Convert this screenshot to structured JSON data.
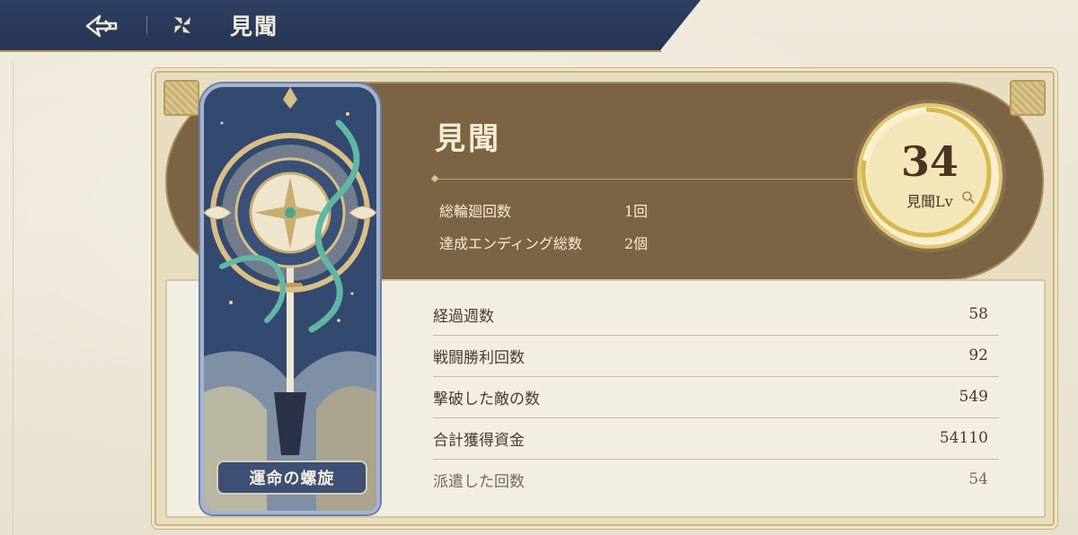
{
  "header": {
    "title": "見聞"
  },
  "card": {
    "name": "運命の螺旋"
  },
  "summary": {
    "title": "見聞",
    "stats": [
      {
        "label": "総輪廻回数",
        "value": "1回"
      },
      {
        "label": "達成エンディング総数",
        "value": "2個"
      }
    ],
    "level": {
      "value": "34",
      "label": "見聞Lv",
      "progress": 0.78
    }
  },
  "stats": [
    {
      "label": "経過週数",
      "value": "58"
    },
    {
      "label": "戦闘勝利回数",
      "value": "92"
    },
    {
      "label": "撃破した敵の数",
      "value": "549"
    },
    {
      "label": "合計獲得資金",
      "value": "54110"
    },
    {
      "label": "派遣した回数",
      "value": "54"
    }
  ],
  "colors": {
    "topbar": "#2f3f63",
    "accent_gold": "#cdb57b",
    "head_brown": "#7b6344",
    "card_blue": "#415980"
  },
  "icons": {
    "back": "back-arrow-icon",
    "module": "four-petal-icon",
    "magnify": "magnifier-icon"
  }
}
